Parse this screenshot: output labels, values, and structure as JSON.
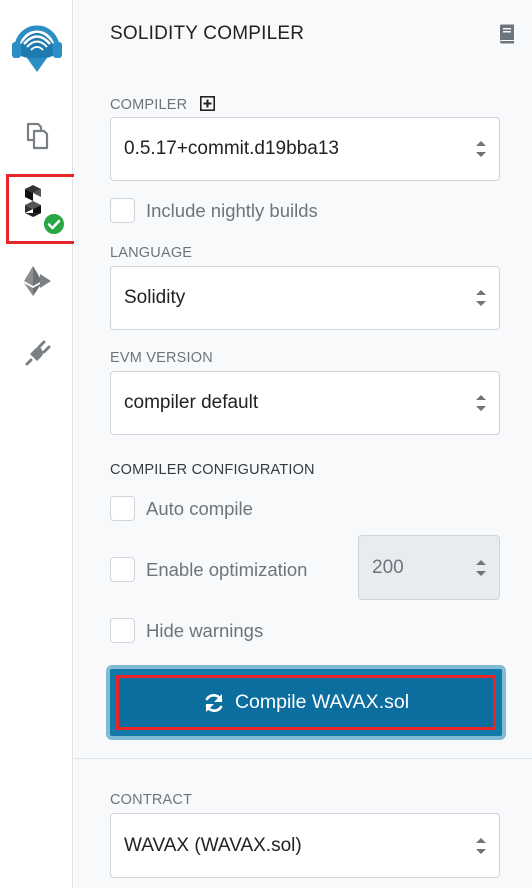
{
  "panel": {
    "title": "SOLIDITY COMPILER",
    "compiler_label": "COMPILER",
    "compiler_value": "0.5.17+commit.d19bba13",
    "nightly_label": "Include nightly builds",
    "language_label": "LANGUAGE",
    "language_value": "Solidity",
    "evm_label": "EVM VERSION",
    "evm_value": "compiler default",
    "config_label": "COMPILER CONFIGURATION",
    "auto_compile_label": "Auto compile",
    "optimization_label": "Enable optimization",
    "runs_value": "200",
    "hide_warnings_label": "Hide warnings",
    "compile_button": "Compile WAVAX.sol",
    "contract_label": "CONTRACT",
    "contract_value": "WAVAX (WAVAX.sol)"
  },
  "colors": {
    "accent": "#0b6e9e",
    "highlight": "#e8262a",
    "success": "#28a745"
  },
  "icons": [
    "remix-logo-icon",
    "file-explorer-icon",
    "solidity-compiler-icon",
    "check-circle-icon",
    "deploy-run-icon",
    "plugin-manager-icon",
    "docs-book-icon",
    "add-compiler-icon",
    "refresh-icon",
    "select-arrows-icon"
  ]
}
